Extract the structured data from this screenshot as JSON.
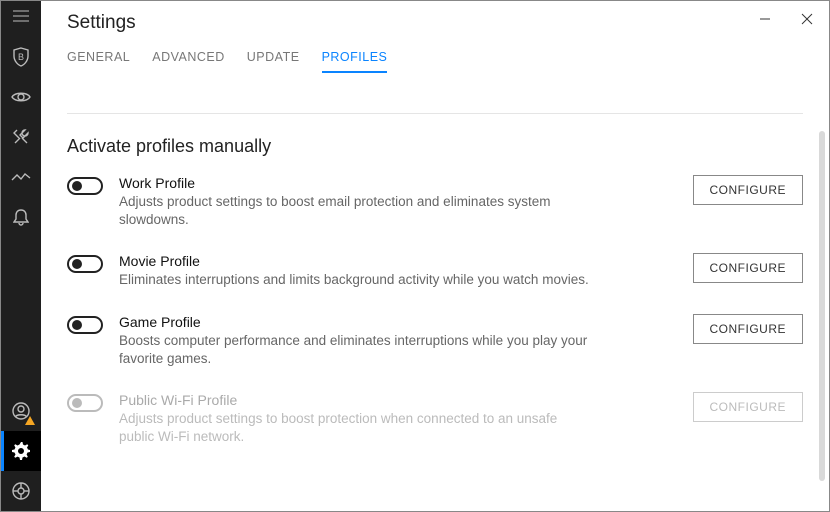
{
  "header": {
    "title": "Settings"
  },
  "tabs": {
    "general": "GENERAL",
    "advanced": "ADVANCED",
    "update": "UPDATE",
    "profiles": "PROFILES"
  },
  "section": {
    "title": "Activate profiles manually"
  },
  "profiles": [
    {
      "title": "Work Profile",
      "desc": "Adjusts product settings to boost email protection and eliminates system slowdowns.",
      "button": "CONFIGURE"
    },
    {
      "title": "Movie Profile",
      "desc": "Eliminates interruptions and limits background activity while you watch movies.",
      "button": "CONFIGURE"
    },
    {
      "title": "Game Profile",
      "desc": "Boosts computer performance and eliminates interruptions while you play your favorite games.",
      "button": "CONFIGURE"
    },
    {
      "title": "Public Wi-Fi Profile",
      "desc": "Adjusts product settings to boost protection when connected to an unsafe public Wi-Fi network.",
      "button": "CONFIGURE"
    }
  ]
}
